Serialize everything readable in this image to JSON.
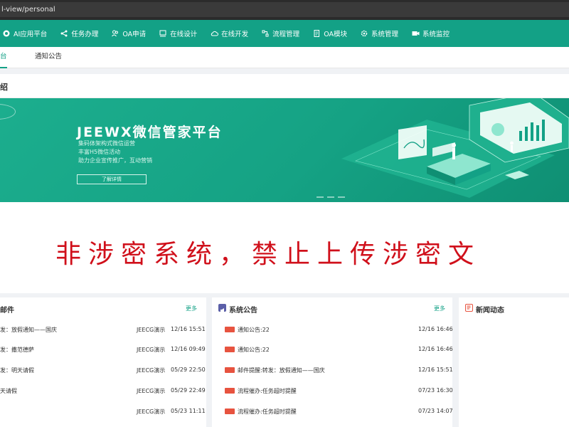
{
  "browser": {
    "url": "l-view/personal"
  },
  "nav": {
    "items": [
      {
        "label": "AI应用平台",
        "icon": "ai-icon"
      },
      {
        "label": "任务办理",
        "icon": "share-icon"
      },
      {
        "label": "OA申请",
        "icon": "people-icon"
      },
      {
        "label": "在线设计",
        "icon": "design-icon"
      },
      {
        "label": "在线开发",
        "icon": "cloud-icon"
      },
      {
        "label": "流程管理",
        "icon": "flow-icon"
      },
      {
        "label": "OA模块",
        "icon": "doc-icon"
      },
      {
        "label": "系统管理",
        "icon": "gear-icon"
      },
      {
        "label": "系统监控",
        "icon": "camera-icon"
      }
    ]
  },
  "tabs": [
    {
      "label": "台",
      "active": true
    },
    {
      "label": "通知公告",
      "active": false
    }
  ],
  "banner_card": {
    "title": "绍",
    "headline": "JEEWX微信管家平台",
    "lines": [
      "集码体架构式微信运营",
      "丰富H5微信活动",
      "助力企业宣传推广，互动营销"
    ],
    "button": "了解详情"
  },
  "warning": "非涉密系统，禁止上传涉密文",
  "mail_panel": {
    "title": "邮件",
    "more": "更多",
    "rows": [
      {
        "subject": "发：放假通知——国庆",
        "sender": "JEECG演示",
        "time": "12/16 15:51"
      },
      {
        "subject": "发：撒范德萨",
        "sender": "JEECG演示",
        "time": "12/16 09:49"
      },
      {
        "subject": "发：明天请假",
        "sender": "JEECG演示",
        "time": "05/29 22:50"
      },
      {
        "subject": "天请假",
        "sender": "JEECG演示",
        "time": "05/29 22:49"
      },
      {
        "subject": "",
        "sender": "JEECG演示",
        "time": "05/23 11:11"
      }
    ]
  },
  "notice_panel": {
    "title": "系统公告",
    "more": "更多",
    "tag_color": "#e7533f",
    "rows": [
      {
        "subject": "通知公告:22",
        "time": "12/16 16:46"
      },
      {
        "subject": "通知公告:22",
        "time": "12/16 16:46"
      },
      {
        "subject": "邮件提醒:转发：放假通知——国庆",
        "time": "12/16 15:51"
      },
      {
        "subject": "流程催办:任务超时提醒",
        "time": "07/23 16:30"
      },
      {
        "subject": "流程催办:任务超时提醒",
        "time": "07/23 14:07"
      }
    ]
  },
  "news_panel": {
    "title": "新闻动态"
  },
  "colors": {
    "primary": "#13a186",
    "warning": "#d0101b"
  }
}
